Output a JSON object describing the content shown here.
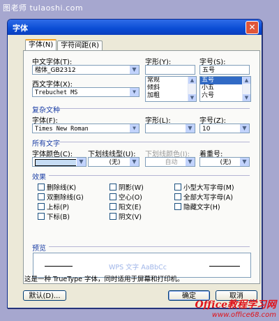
{
  "watermark_top": "图老师 tulaoshi.com",
  "window": {
    "title": "字体",
    "close_glyph": "✕"
  },
  "tabs": [
    {
      "label": "字体(N)"
    },
    {
      "label": "字符间距(R)"
    }
  ],
  "font": {
    "cn_label": "中文字体(T):",
    "cn_value": "楷体_GB2312",
    "west_label": "西文字体(X):",
    "west_value": "Trebuchet MS",
    "style_label": "字形(Y):",
    "style_value": "",
    "style_items": [
      "常规",
      "倾斜",
      "加粗"
    ],
    "size_label": "字号(S):",
    "size_value": "五号",
    "size_items": [
      "五号",
      "小五",
      "六号"
    ]
  },
  "complex": {
    "heading": "复杂文种",
    "font_label": "字体(F):",
    "font_value": "Times New Roman",
    "style_label": "字形(L):",
    "style_value": "",
    "size_label": "字号(Z):",
    "size_value": "10"
  },
  "all_text": {
    "heading": "所有文字",
    "color_label": "字体颜色(C):",
    "color_value": "#c6dcf4",
    "underline_label": "下划线线型(U):",
    "underline_value": "(无)",
    "ucolor_label": "下划线颜色(I):",
    "ucolor_value": "自动",
    "emphasis_label": "着重号:",
    "emphasis_value": "(无)"
  },
  "effects": {
    "heading": "效果",
    "items": [
      {
        "label": "删除线(K)"
      },
      {
        "label": "双删除线(G)"
      },
      {
        "label": "上标(P)"
      },
      {
        "label": "下标(B)"
      },
      {
        "label": "阴影(W)"
      },
      {
        "label": "空心(O)"
      },
      {
        "label": "阳文(E)"
      },
      {
        "label": "阴文(V)"
      },
      {
        "label": "小型大写字母(M)"
      },
      {
        "label": "全部大写字母(A)"
      },
      {
        "label": "隐藏文字(H)"
      }
    ]
  },
  "preview": {
    "heading": "预览",
    "sample": "WPS 文字 AaBbCc"
  },
  "info": "这是一种 TrueType 字体，同时适用于屏幕和打印机。",
  "buttons": {
    "default": "默认(D)...",
    "ok": "确定",
    "cancel": "取消"
  },
  "watermark_bottom": {
    "line1": "Office教程学习网",
    "line2": "www.office68.com"
  }
}
